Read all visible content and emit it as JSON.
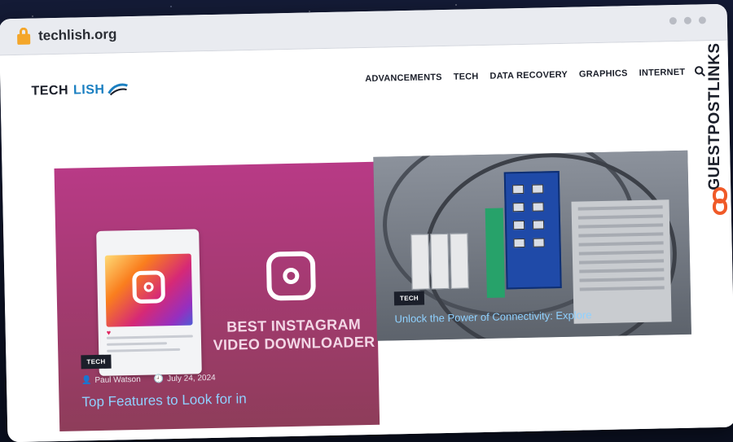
{
  "browser": {
    "url": "techlish.org"
  },
  "site": {
    "logo_part1": "TECH",
    "logo_part2": "LISH",
    "nav": [
      "ADVANCEMENTS",
      "TECH",
      "DATA RECOVERY",
      "GRAPHICS",
      "INTERNET"
    ]
  },
  "posts": [
    {
      "image_caption": "BEST INSTAGRAM VIDEO DOWNLOADER",
      "category": "TECH",
      "author": "Paul Watson",
      "date": "July 24, 2024",
      "title": "Top Features to Look for in"
    },
    {
      "category": "TECH",
      "title": "Unlock the Power of Connectivity: Explore"
    }
  ],
  "watermark": {
    "text": "GUESTPOSTLINKS"
  },
  "colors": {
    "accent": "#1a7fc1",
    "lock": "#f4a62a",
    "watermark": "#1b1f2a",
    "watermark_icon": "#f05a28",
    "post_title": "#8fd1ff"
  }
}
